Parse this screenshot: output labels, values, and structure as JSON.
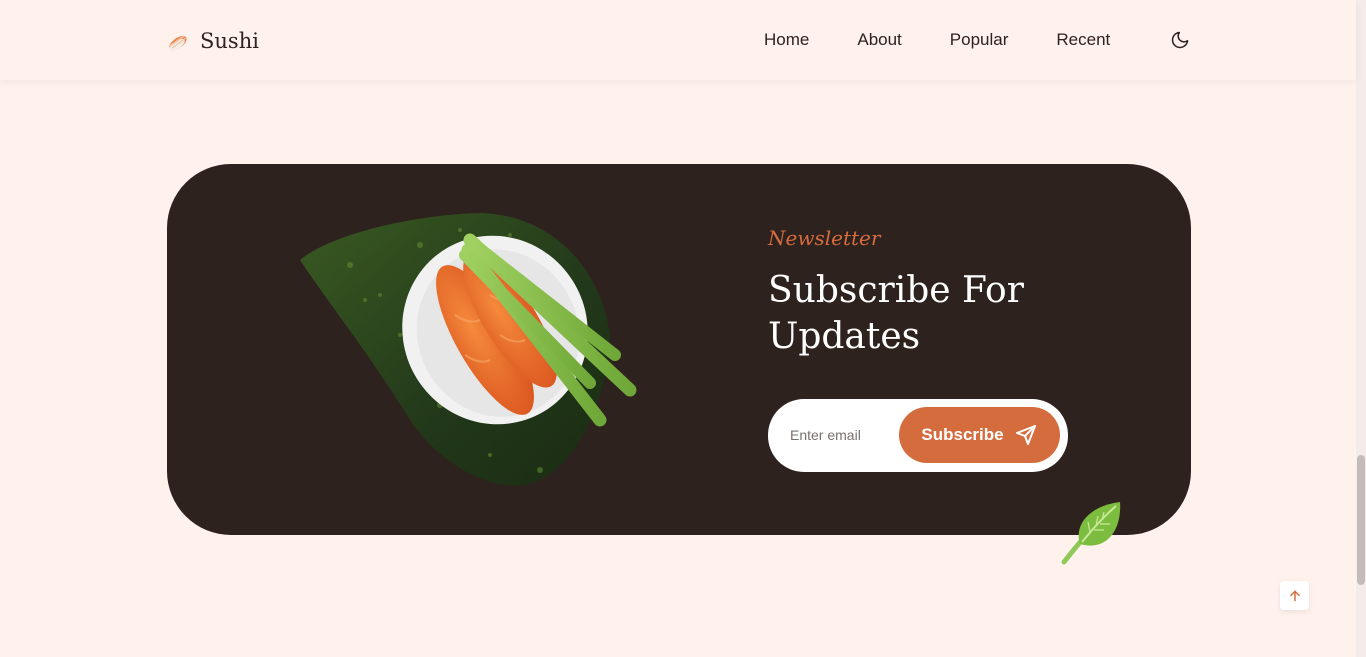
{
  "header": {
    "logo_text": "Sushi",
    "logo_icon": "sushi-icon",
    "nav": [
      "Home",
      "About",
      "Popular",
      "Recent"
    ],
    "theme_icon": "moon-icon"
  },
  "newsletter": {
    "kicker": "Newsletter",
    "title": "Subscribe For Updates",
    "email_placeholder": "Enter email",
    "button_label": "Subscribe",
    "button_icon": "send-icon",
    "image": "temaki-hand-roll",
    "decoration": "leaf-icon"
  },
  "scroll_up_icon": "arrow-up-icon",
  "colors": {
    "background": "#fff1ec",
    "card": "#2e221e",
    "accent": "#d46c3e",
    "text_dark": "#2e221e",
    "text_light": "#ffffff"
  }
}
